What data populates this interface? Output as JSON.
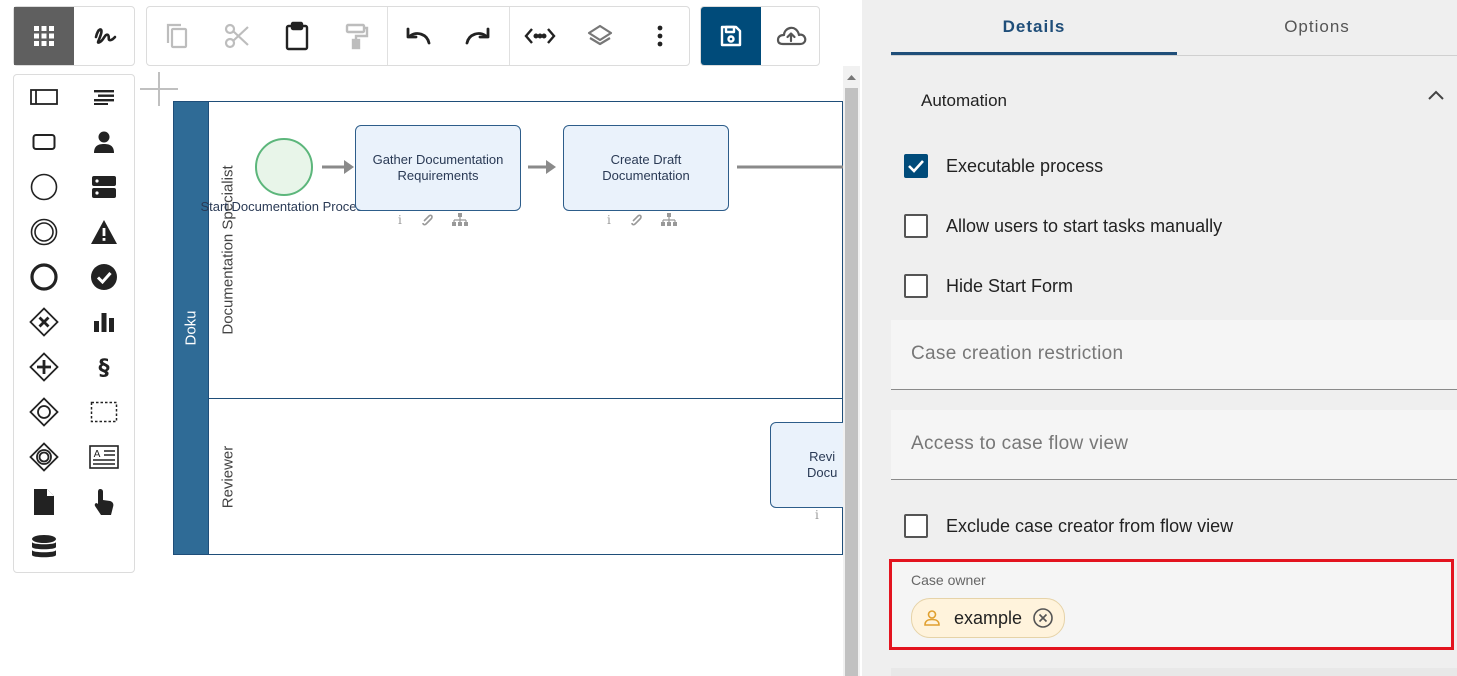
{
  "toolbar": {
    "modes": [
      {
        "icon": "grid-icon",
        "active": true
      },
      {
        "icon": "freehand-icon",
        "active": false
      }
    ],
    "actions": [
      "copy-icon",
      "cut-icon",
      "paste-icon",
      "format-paint-icon",
      "undo-icon",
      "redo-icon",
      "code-arrows-icon",
      "layers-icon",
      "more-vertical-icon"
    ],
    "save_icon": "save-icon",
    "publish_icon": "cloud-upload-icon"
  },
  "palette": {
    "items": [
      "lane-icon",
      "text-annotation-icon",
      "task-icon",
      "user-task-icon",
      "start-event-icon",
      "service-task-icon",
      "intermediate-event-icon",
      "error-event-icon",
      "end-event-icon",
      "check-icon",
      "exclusive-gateway-icon",
      "chart-icon",
      "parallel-gateway-icon",
      "section-icon",
      "inclusive-gateway-icon",
      "group-icon",
      "event-gateway-icon",
      "form-icon",
      "document-icon",
      "touch-icon",
      "database-icon"
    ]
  },
  "diagram": {
    "pool_label": "Doku",
    "lanes": [
      "Documentation Specialist",
      "Reviewer"
    ],
    "start_event_label": "Start Documentation Process",
    "tasks": [
      {
        "label": "Gather Documentation Requirements"
      },
      {
        "label": "Create Draft Documentation"
      },
      {
        "label": "Revi\nDocu"
      }
    ],
    "task_icon_glyph": "i"
  },
  "panel": {
    "tabs": {
      "details": "Details",
      "options": "Options"
    },
    "section_title": "Automation",
    "checkboxes": [
      {
        "label": "Executable process",
        "checked": true
      },
      {
        "label": "Allow users to start tasks manually",
        "checked": false
      },
      {
        "label": "Hide Start Form",
        "checked": false
      }
    ],
    "fields": [
      "Case creation restriction",
      "Access to case flow view"
    ],
    "exclude_checkbox": {
      "label": "Exclude case creator from flow view",
      "checked": false
    },
    "case_owner": {
      "label": "Case owner",
      "chip": "example"
    }
  },
  "colors": {
    "brand": "#004b7a",
    "pool": "#2f6b96",
    "highlight": "#e3141f",
    "start_event": "#5cb67b"
  }
}
